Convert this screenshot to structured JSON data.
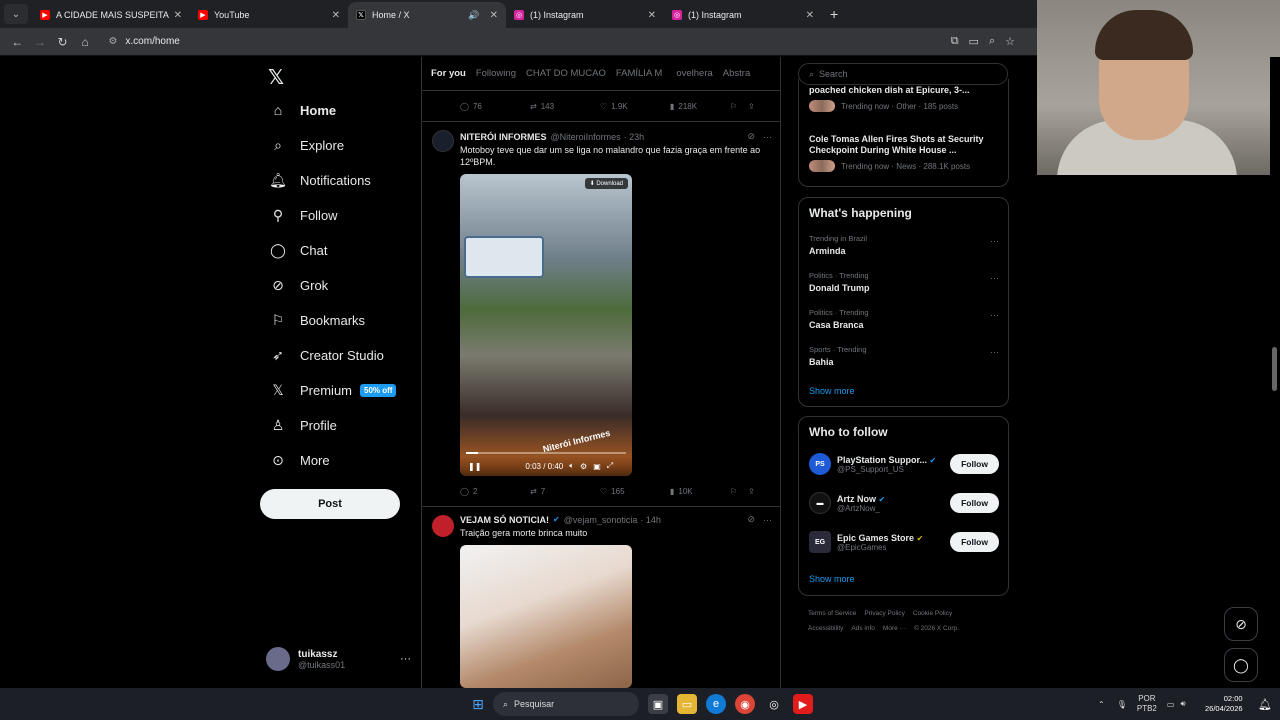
{
  "browser": {
    "tabs": [
      {
        "title": "A CIDADE MAIS SUSPEITA DO N",
        "favicon_color": "#ff0000",
        "active": false
      },
      {
        "title": "YouTube",
        "favicon_color": "#ff0000",
        "active": false
      },
      {
        "title": "Home / X",
        "favicon_color": "#000000",
        "active": true
      },
      {
        "title": "(1) Instagram",
        "favicon_color": "#d6249f",
        "active": false
      },
      {
        "title": "(1) Instagram",
        "favicon_color": "#d6249f",
        "active": false
      }
    ],
    "url": "x.com/home"
  },
  "nav": {
    "items": [
      {
        "label": "Home",
        "icon": "home-icon"
      },
      {
        "label": "Explore",
        "icon": "search-icon"
      },
      {
        "label": "Notifications",
        "icon": "bell-icon"
      },
      {
        "label": "Follow",
        "icon": "person-plus-icon"
      },
      {
        "label": "Chat",
        "icon": "chat-icon"
      },
      {
        "label": "Grok",
        "icon": "grok-icon"
      },
      {
        "label": "Bookmarks",
        "icon": "bookmark-icon"
      },
      {
        "label": "Creator Studio",
        "icon": "rocket-icon"
      },
      {
        "label": "Premium",
        "icon": "x-icon",
        "badge": "50% off"
      },
      {
        "label": "Profile",
        "icon": "person-icon"
      },
      {
        "label": "More",
        "icon": "more-circle-icon"
      }
    ],
    "post_label": "Post",
    "user": {
      "name": "tuikassz",
      "handle": "@tuikass01"
    }
  },
  "timeline": {
    "tabs": [
      "For you",
      "Following",
      "CHAT DO MUCAO",
      "FAMÍLIA M",
      "ovelhera",
      "Abstra"
    ],
    "top_actions": {
      "replies": "76",
      "reposts": "143",
      "likes": "1.9K",
      "views": "218K"
    },
    "tweet1": {
      "name": "NITERÓI INFORMES",
      "handle": "@NiteroiInformes",
      "time": "· 23h",
      "text": "Motoboy teve que dar um se liga no malandro que fazia graça em frente ao 12ºBPM.",
      "download_label": "Download",
      "watermark": "Niterói Informes",
      "video_time": "0:03 / 0:40",
      "progress": 0.075,
      "actions": {
        "replies": "2",
        "reposts": "7",
        "likes": "165",
        "views": "10K"
      }
    },
    "tweet2": {
      "name": "VEJAM SÓ NOTICIA!",
      "handle": "@vejam_sonoticia",
      "time": "· 14h",
      "text": "Traição gera morte brinca muito"
    }
  },
  "sidebar": {
    "search_placeholder": "Search",
    "news": [
      {
        "title": "poached chicken dish at Epicure, 3-...",
        "meta": "Trending now · Other · 185 posts"
      },
      {
        "title": "Cole Tomas Allen Fires Shots at Security Checkpoint During White House ...",
        "meta": "Trending now · News · 288.1K posts"
      }
    ],
    "whats_happening": {
      "title": "What's happening",
      "trends": [
        {
          "context": "Trending in Brazil",
          "name": "Arminda"
        },
        {
          "context": "Politics · Trending",
          "name": "Donald Trump"
        },
        {
          "context": "Politics · Trending",
          "name": "Casa Branca"
        },
        {
          "context": "Sports · Trending",
          "name": "Bahia"
        }
      ],
      "show_more": "Show more"
    },
    "who_to_follow": {
      "title": "Who to follow",
      "accounts": [
        {
          "name": "PlayStation Suppor...",
          "handle": "@PS_Support_US",
          "avatar_color": "#1f5bd6",
          "verified": "blue"
        },
        {
          "name": "Artz Now",
          "handle": "@ArtzNow_",
          "avatar_color": "#111111",
          "verified": "blue"
        },
        {
          "name": "Epic Games Store",
          "handle": "@EpicGames",
          "avatar_color": "#2a2a3a",
          "verified": "gold"
        }
      ],
      "follow_label": "Follow",
      "show_more": "Show more"
    },
    "footer": [
      "Terms of Service",
      "Privacy Policy",
      "Cookie Policy",
      "Accessibility",
      "Ads info",
      "More ···",
      "© 2026 X Corp."
    ]
  },
  "taskbar": {
    "search_placeholder": "Pesquisar",
    "lang1": "POR",
    "lang2": "PTB2",
    "time": "02:00",
    "date": "26/04/2026"
  }
}
